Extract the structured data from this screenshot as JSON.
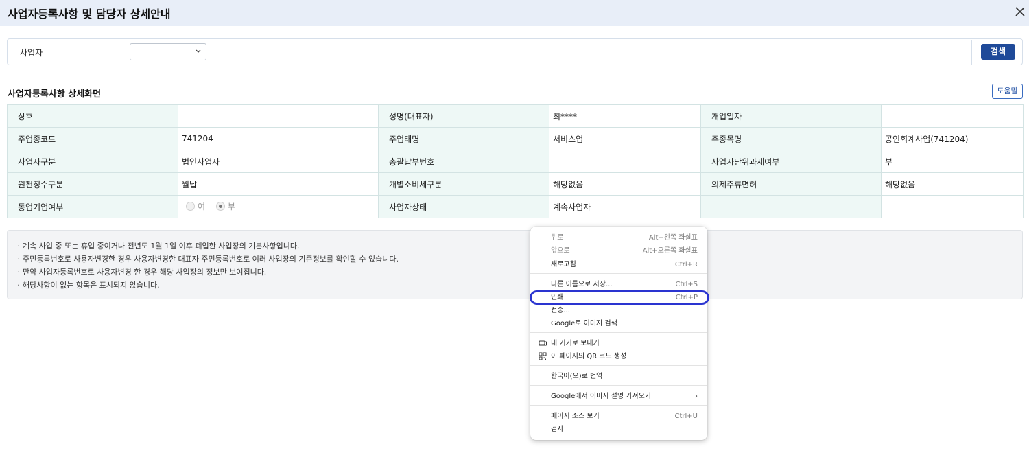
{
  "window": {
    "title": "사업자등록사항 및 담당자 상세안내",
    "close_icon": "close-icon"
  },
  "search": {
    "label": "사업자",
    "select_value": "",
    "button": "검색"
  },
  "section": {
    "title": "사업자등록사항 상세화면",
    "help_button": "도움말"
  },
  "table": {
    "rows": [
      [
        {
          "h": "상호"
        },
        {
          "v": ""
        },
        {
          "h": "성명(대표자)"
        },
        {
          "v": "최****"
        },
        {
          "h": "개업일자"
        },
        {
          "v": ""
        }
      ],
      [
        {
          "h": "주업종코드"
        },
        {
          "v": "741204"
        },
        {
          "h": "주업태명"
        },
        {
          "v": "서비스업"
        },
        {
          "h": "주종목명"
        },
        {
          "v": "공인회계사업(741204)"
        }
      ],
      [
        {
          "h": "사업자구분"
        },
        {
          "v": "법인사업자"
        },
        {
          "h": "총괄납부번호"
        },
        {
          "v": ""
        },
        {
          "h": "사업자단위과세여부"
        },
        {
          "v": "부"
        }
      ],
      [
        {
          "h": "원천징수구분"
        },
        {
          "v": "월납"
        },
        {
          "h": "개별소비세구분"
        },
        {
          "v": "해당없음"
        },
        {
          "h": "의제주류면허"
        },
        {
          "v": "해당없음"
        }
      ]
    ],
    "last_row": {
      "h1": "동업기업여부",
      "radio_yes": "여",
      "radio_no": "부",
      "selected": "부",
      "h2": "사업자상태",
      "v2": "계속사업자"
    }
  },
  "notes": [
    "계속 사업 중 또는 휴업 중이거나 전년도 1월 1일 이후 폐업한 사업장의 기본사항입니다.",
    "주민등록번호로 사용자변경한 경우 사용자변경한 대표자 주민등록번호로 여러 사업장의 기존정보를 확인할 수 있습니다.",
    "만약 사업자등록번호로 사용자변경 한 경우 해당 사업장의 정보만 보여집니다.",
    "해당사항이 없는 항목은 표시되지 않습니다."
  ],
  "context_menu": {
    "items": [
      {
        "label": "뒤로",
        "shortcut": "Alt+왼쪽 화살표",
        "disabled": true
      },
      {
        "label": "앞으로",
        "shortcut": "Alt+오른쪽 화살표",
        "disabled": true
      },
      {
        "label": "새로고침",
        "shortcut": "Ctrl+R",
        "disabled": false
      },
      {
        "label": "다른 이름으로 저장...",
        "shortcut": "Ctrl+S",
        "disabled": false
      },
      {
        "label": "인쇄",
        "shortcut": "Ctrl+P",
        "disabled": false,
        "highlighted": true
      },
      {
        "label": "전송...",
        "shortcut": "",
        "disabled": false
      },
      {
        "label": "Google로 이미지 검색",
        "shortcut": "",
        "disabled": false
      },
      {
        "label": "내 기기로 보내기",
        "shortcut": "",
        "disabled": false,
        "icon": "device-icon"
      },
      {
        "label": "이 페이지의 QR 코드 생성",
        "shortcut": "",
        "disabled": false,
        "icon": "qr-code-icon"
      },
      {
        "label": "한국어(으)로 번역",
        "shortcut": "",
        "disabled": false
      },
      {
        "label": "Google에서 이미지 설명 가져오기",
        "shortcut": "",
        "disabled": false,
        "submenu": true
      },
      {
        "label": "페이지 소스 보기",
        "shortcut": "Ctrl+U",
        "disabled": false
      },
      {
        "label": "검사",
        "shortcut": "",
        "disabled": false
      }
    ],
    "submenu_arrow": "›"
  }
}
